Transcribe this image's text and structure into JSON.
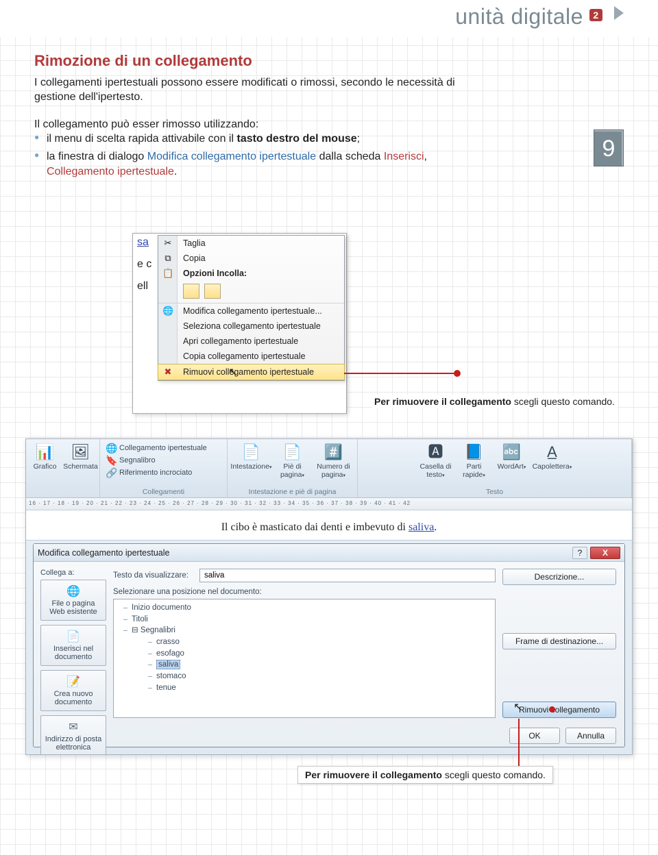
{
  "header": {
    "title": "unità digitale",
    "badge": "2"
  },
  "section": {
    "title": "Rimozione di un collegamento",
    "p1": "I collegamenti ipertestuali possono essere modificati o rimossi, secondo le necessità di gestione dell'ipertesto.",
    "p2": "Il collegamento può esser rimosso utilizzando:",
    "b1_pre": "il menu di scelta rapida attivabile con il ",
    "b1_bold": "tasto destro del mouse",
    "b1_post": ";",
    "b2_pre": "la finestra di dialogo ",
    "b2_blue": "Modifica collegamento ipertestuale",
    "b2_mid": " dalla scheda ",
    "b2_red": "Inserisci",
    "b2_post": ", ",
    "b2_red2": "Collegamento ipertestuale",
    "b2_end": "."
  },
  "screenshot1": {
    "doc_bits": {
      "l1": "sa",
      "l2": "e c",
      "l3": "ell"
    },
    "menu": {
      "taglia": "Taglia",
      "copia": "Copia",
      "opzioni_label": "Opzioni Incolla:",
      "modifica": "Modifica collegamento ipertestuale...",
      "seleziona": "Seleziona collegamento ipertestuale",
      "apri": "Apri collegamento ipertestuale",
      "copia2": "Copia collegamento ipertestuale",
      "rimuovi": "Rimuovi collegamento ipertestuale"
    }
  },
  "callout1": {
    "bold": "Per rimuovere il collegamento ",
    "rest": "scegli questo comando."
  },
  "ribbon": {
    "grafico": "Grafico",
    "schermata": "Schermata",
    "collegamento": "Collegamento ipertestuale",
    "segnalibro": "Segnalibro",
    "riferimento": "Riferimento incrociato",
    "grp_collegamenti": "Collegamenti",
    "intestazione": "Intestazione",
    "pie": "Piè di pagina",
    "numero": "Numero di pagina",
    "grp_intest": "Intestazione e piè di pagina",
    "casella": "Casella di testo",
    "parti": "Parti rapide",
    "wordart": "WordArt",
    "capolettera": "Capolettera",
    "grp_testo": "Testo"
  },
  "ruler_text": "16 · 17 · 18 · 19 · 20 · 21 · 22 · 23 · 24 · 25 · 26 · 27 · 28 · 29 · 30 · 31 · 32 · 33 · 34 · 35 · 36 · 37 · 38 · 39 · 40 · 41 · 42",
  "doc_sentence": {
    "pre": "Il cibo è masticato dai denti e imbevuto di ",
    "link": "saliva",
    "post": "."
  },
  "dialog": {
    "title": "Modifica collegamento ipertestuale",
    "help": "?",
    "close": "X",
    "collega_label": "Collega a:",
    "left_buttons": {
      "file": "File o pagina Web esistente",
      "inserisci": "Inserisci nel documento",
      "crea": "Crea nuovo documento",
      "email": "Indirizzo di posta elettronica"
    },
    "testo_label": "Testo da visualizzare:",
    "testo_value": "saliva",
    "pos_label": "Selezionare una posizione nel documento:",
    "tree": {
      "inizio": "Inizio documento",
      "titoli": "Titoli",
      "segnalibri": "Segnalibri",
      "items": [
        "crasso",
        "esofago",
        "saliva",
        "stomaco",
        "tenue"
      ]
    },
    "descrizione": "Descrizione...",
    "frame": "Frame di destinazione...",
    "rimuovi": "Rimuovi collegamento",
    "ok": "OK",
    "annulla": "Annulla"
  },
  "callout2": {
    "bold": "Per rimuovere il collegamento ",
    "rest": "scegli questo comando."
  },
  "page_number": "9"
}
